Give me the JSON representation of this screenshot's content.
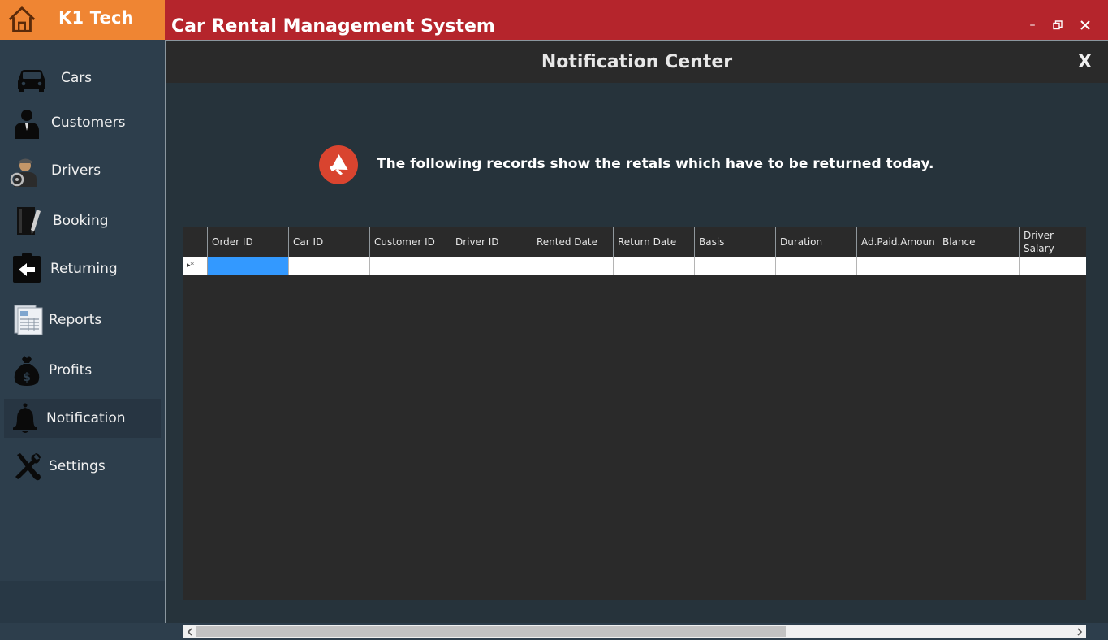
{
  "brand": {
    "name": "K1 Tech",
    "icon": "home-icon"
  },
  "app": {
    "title": "Car Rental Management System"
  },
  "window_controls": {
    "minimize": "–",
    "restore": "🗗",
    "close": "✕"
  },
  "sidebar": {
    "items": [
      {
        "label": "Cars",
        "icon": "car-icon"
      },
      {
        "label": "Customers",
        "icon": "customer-icon"
      },
      {
        "label": "Drivers",
        "icon": "driver-icon"
      },
      {
        "label": "Booking",
        "icon": "booking-icon"
      },
      {
        "label": "Returning",
        "icon": "returning-icon"
      },
      {
        "label": "Reports",
        "icon": "reports-icon"
      },
      {
        "label": "Profits",
        "icon": "money-bag-icon"
      },
      {
        "label": "Notification",
        "icon": "bell-icon",
        "active": true
      },
      {
        "label": "Settings",
        "icon": "tools-icon"
      }
    ]
  },
  "panel": {
    "title": "Notification Center",
    "close_label": "X",
    "notice": "The following records show the retals which have to be returned today."
  },
  "grid": {
    "columns": [
      "Order ID",
      "Car ID",
      "Customer ID",
      "Driver ID",
      "Rented Date",
      "Return Date",
      "Basis",
      "Duration",
      "Ad.Paid.Amoun",
      "Blance",
      "Driver Salary"
    ],
    "new_row_marker": "▸*",
    "rows": []
  },
  "colors": {
    "brand": "#ef8533",
    "titlebar": "#b5252c",
    "sidebar": "#2d3e4c",
    "selection": "#3399ff",
    "notice_icon": "#d9442f"
  }
}
